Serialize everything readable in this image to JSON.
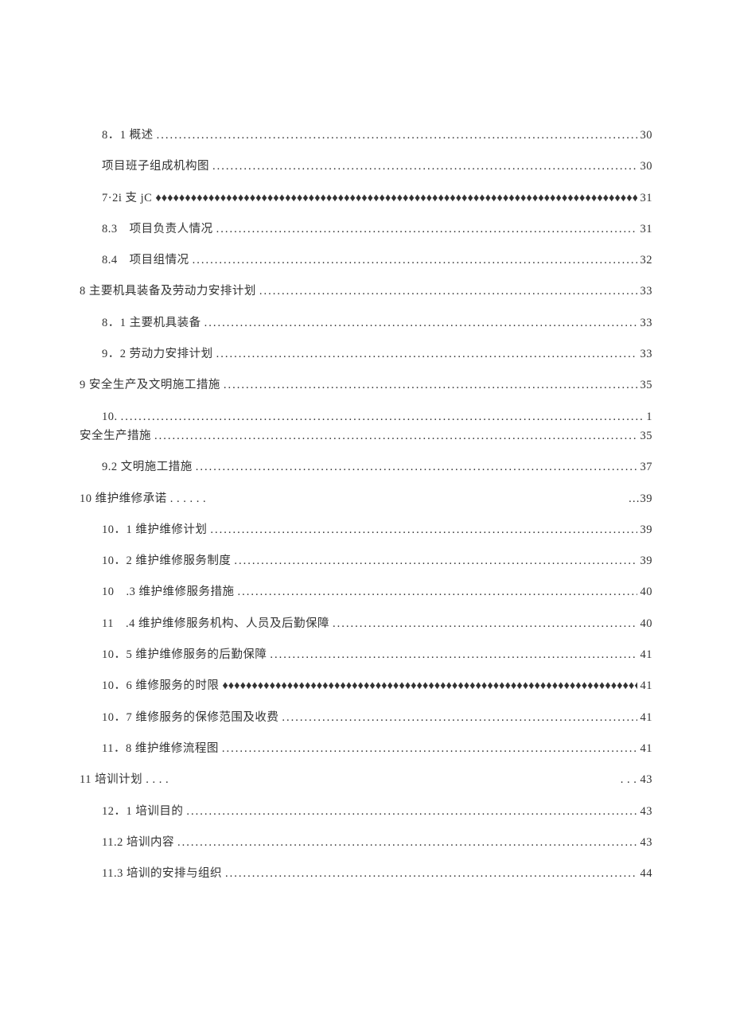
{
  "toc": [
    {
      "indent": 1,
      "label": "8．1 概述 ",
      "leader": "dots",
      "page": "30"
    },
    {
      "indent": 1,
      "label": "项目班子组成机构图 ",
      "leader": "dots",
      "page": "30"
    },
    {
      "indent": 1,
      "label": "7·2i 支 jC",
      "leader": "diamond",
      "page": "31"
    },
    {
      "indent": 1,
      "label": "8.3　项目负责人情况",
      "leader": "dots",
      "page": "31"
    },
    {
      "indent": 1,
      "label": "8.4　项目组情况",
      "leader": "dots",
      "page": "32"
    },
    {
      "indent": 0,
      "label": "8 主要机具装备及劳动力安排计划 ",
      "leader": "dots",
      "page": "33"
    },
    {
      "indent": 1,
      "label": "8．1 主要机具装备 ",
      "leader": "dots",
      "page": "33"
    },
    {
      "indent": 1,
      "label": "9．2 劳动力安排计划 ",
      "leader": "dots",
      "page": "33"
    },
    {
      "indent": 0,
      "label": "9 安全生产及文明施工措施 ",
      "leader": "dots",
      "page": "35"
    },
    {
      "indent": 1,
      "label": "10.",
      "leader": "dots",
      "page": "1",
      "stackWith": {
        "indent": 0,
        "label": "安全生产措施 ",
        "leader": "dots",
        "page": "35"
      }
    },
    {
      "indent": 1,
      "label": "9.2 文明施工措施 ",
      "leader": "dots",
      "page": "37"
    },
    {
      "indent": 0,
      "label": "10 维护维修承诺 . . . . . .",
      "leader": "gap",
      "page": "…39"
    },
    {
      "indent": 1,
      "label": "10．1 维护维修计划 ",
      "leader": "dots",
      "page": "39"
    },
    {
      "indent": 1,
      "label": "10．2 维护维修服务制度 ",
      "leader": "dots",
      "page": "39"
    },
    {
      "indent": 1,
      "label": "10　.3 维护维修服务措施",
      "leader": "dots",
      "page": "40"
    },
    {
      "indent": 1,
      "label": "11　.4 维护维修服务机构、人员及后勤保障",
      "leader": "dots",
      "page": "40"
    },
    {
      "indent": 1,
      "label": "10．5 维护维修服务的后勤保障 ",
      "leader": "dots",
      "page": "41"
    },
    {
      "indent": 1,
      "label": "10．6 维修服务的时限",
      "leader": "diamond",
      "page": "41"
    },
    {
      "indent": 1,
      "label": "10．7 维修服务的保修范围及收费 ",
      "leader": "dots",
      "page": "41"
    },
    {
      "indent": 1,
      "label": "11．8 维护维修流程图 ",
      "leader": "dots",
      "page": "41"
    },
    {
      "indent": 0,
      "label": "11 培训计划 . . . .",
      "leader": "gap",
      "page": ". . . 43"
    },
    {
      "indent": 1,
      "label": "12．1 培训目的 ",
      "leader": "dots",
      "page": "43"
    },
    {
      "indent": 1,
      "label": "11.2  培训内容 ",
      "leader": "dots",
      "page": "43"
    },
    {
      "indent": 1,
      "label": "11.3  培训的安排与组织 ",
      "leader": "dots",
      "page": "44"
    }
  ],
  "leaders": {
    "dots": "..................................................................................................................................................................",
    "diamond": "♦♦♦♦♦♦♦♦♦♦♦♦♦♦♦♦♦♦♦♦♦♦♦♦♦♦♦♦♦♦♦♦♦♦♦♦♦♦♦♦♦♦♦♦♦♦♦♦♦♦♦♦♦♦♦♦♦♦♦♦♦♦♦♦♦♦♦♦♦♦♦♦♦♦♦♦♦♦♦♦♦♦♦♦♦♦♦♦♦♦♦♦♦♦♦♦♦♦♦♦♦♦♦♦",
    "gap": " "
  }
}
